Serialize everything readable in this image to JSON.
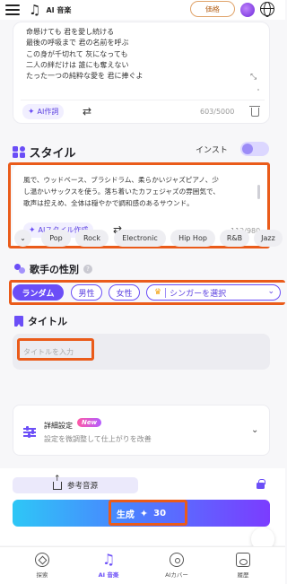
{
  "header": {
    "brand": "AI 音楽",
    "price_label": "価格"
  },
  "lyrics": {
    "lines": [
      "命懸けても 君を愛し続ける",
      "最後の呼吸まで 君の名前を呼ぶ",
      "この身が千切れて 灰になっても",
      "二人の絆だけは 誰にも奪えない",
      "たった一つの純粋な愛を 君に捧ぐよ"
    ],
    "ai_button_label": "AI作詞",
    "counter": "603/5000"
  },
  "style": {
    "heading": "スタイル",
    "instrumental_label": "インスト",
    "instrumental_on": false,
    "description_lines": [
      "風で、ウッドベース、ブラシドラム、柔らかいジャズピアノ、少",
      "し温かいサックスを使う。落ち着いたカフェジャズの雰囲気で、",
      "歌声は控えめ、全体は穏やかで調和感のあるサウンド。"
    ],
    "ai_button_label": "AIスタイル作成",
    "counter": "112/980",
    "chips": [
      "Pop",
      "Rock",
      "Electronic",
      "Hip Hop",
      "R&B",
      "Jazz"
    ]
  },
  "gender": {
    "heading": "歌手の性別",
    "help": "?",
    "options": [
      "ランダム",
      "男性",
      "女性"
    ],
    "selected": "ランダム",
    "singer_select_label": "シンガーを選択"
  },
  "title": {
    "heading": "タイトル",
    "placeholder": "タイトルを入力"
  },
  "advanced": {
    "title": "詳細設定",
    "badge": "New",
    "subtitle": "設定を微調整して仕上がりを改善"
  },
  "bottom": {
    "reference_label": "参考音源",
    "generate_label": "生成",
    "generate_cost": "30"
  },
  "tabs": [
    {
      "label": "探索",
      "icon": "compass-icon"
    },
    {
      "label": "AI 音楽",
      "icon": "music-note-icon",
      "active": true
    },
    {
      "label": "AIカバー",
      "icon": "disc-icon"
    },
    {
      "label": "履歴",
      "icon": "history-icon"
    }
  ],
  "colors": {
    "accent": "#6b4ef7",
    "highlight_box": "#ea5b1a",
    "generate_gradient_start": "#2ec7f6",
    "generate_gradient_end": "#7b3cff"
  }
}
